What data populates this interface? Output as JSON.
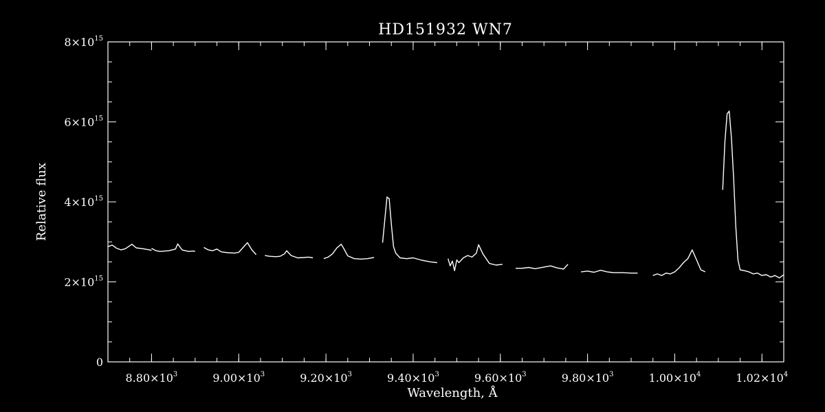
{
  "chart_data": {
    "type": "line",
    "title": "HD151932   WN7",
    "xlabel": "Wavelength, Å",
    "ylabel": "Relative flux",
    "xlim": [
      8700,
      10250
    ],
    "ylim": [
      0,
      8000000000000000.0
    ],
    "grid": false,
    "line_color": "#ffffff",
    "background": "#000000",
    "x_ticks": [
      {
        "value": 8800,
        "mant": "8.80",
        "exp": "3"
      },
      {
        "value": 9000,
        "mant": "9.00",
        "exp": "3"
      },
      {
        "value": 9200,
        "mant": "9.20",
        "exp": "3"
      },
      {
        "value": 9400,
        "mant": "9.40",
        "exp": "3"
      },
      {
        "value": 9600,
        "mant": "9.60",
        "exp": "3"
      },
      {
        "value": 9800,
        "mant": "9.80",
        "exp": "3"
      },
      {
        "value": 10000,
        "mant": "1.00",
        "exp": "4"
      },
      {
        "value": 10200,
        "mant": "1.02",
        "exp": "4"
      }
    ],
    "y_ticks": [
      {
        "value": 0,
        "mant": "0",
        "exp": ""
      },
      {
        "value": 2000000000000000.0,
        "mant": "2",
        "exp": "15"
      },
      {
        "value": 4000000000000000.0,
        "mant": "4",
        "exp": "15"
      },
      {
        "value": 6000000000000000.0,
        "mant": "6",
        "exp": "15"
      },
      {
        "value": 8000000000000000.0,
        "mant": "8",
        "exp": "15"
      }
    ],
    "x_minor_step": 50,
    "y_minor_step": 500000000000000.0,
    "series": [
      {
        "segments": [
          {
            "x": [
              8700,
              8710,
              8720,
              8730,
              8740,
              8755,
              8765,
              8780,
              8790,
              8800
            ],
            "y": [
              2880000000000000.0,
              2920000000000000.0,
              2840000000000000.0,
              2800000000000000.0,
              2830000000000000.0,
              2940000000000000.0,
              2850000000000000.0,
              2830000000000000.0,
              2810000000000000.0,
              2790000000000000.0
            ]
          },
          {
            "x": [
              8800,
              8810,
              8820,
              8840,
              8855,
              8860,
              8870,
              8885,
              8895,
              8900
            ],
            "y": [
              2840000000000000.0,
              2780000000000000.0,
              2760000000000000.0,
              2780000000000000.0,
              2820000000000000.0,
              2950000000000000.0,
              2800000000000000.0,
              2760000000000000.0,
              2770000000000000.0,
              2760000000000000.0
            ]
          },
          {
            "x": [
              8920,
              8930,
              8940,
              8950,
              8960,
              8975,
              8990,
              9000,
              9010,
              9020,
              9030,
              9040
            ],
            "y": [
              2860000000000000.0,
              2800000000000000.0,
              2780000000000000.0,
              2820000000000000.0,
              2750000000000000.0,
              2730000000000000.0,
              2720000000000000.0,
              2740000000000000.0,
              2860000000000000.0,
              2980000000000000.0,
              2800000000000000.0,
              2680000000000000.0
            ]
          },
          {
            "x": [
              9060,
              9070,
              9085,
              9095,
              9105,
              9110,
              9120,
              9135,
              9150,
              9160,
              9170
            ],
            "y": [
              2660000000000000.0,
              2640000000000000.0,
              2630000000000000.0,
              2640000000000000.0,
              2700000000000000.0,
              2780000000000000.0,
              2660000000000000.0,
              2600000000000000.0,
              2610000000000000.0,
              2620000000000000.0,
              2600000000000000.0
            ]
          },
          {
            "x": [
              9195,
              9205,
              9215,
              9225,
              9235,
              9240,
              9250,
              9265,
              9280,
              9295,
              9310
            ],
            "y": [
              2580000000000000.0,
              2620000000000000.0,
              2700000000000000.0,
              2850000000000000.0,
              2940000000000000.0,
              2850000000000000.0,
              2650000000000000.0,
              2580000000000000.0,
              2570000000000000.0,
              2580000000000000.0,
              2610000000000000.0
            ]
          },
          {
            "x": [
              9330,
              9335,
              9340,
              9345,
              9350,
              9355,
              9360,
              9370,
              9385,
              9400,
              9420,
              9440,
              9455
            ],
            "y": [
              2980000000000000.0,
              3550000000000000.0,
              4120000000000000.0,
              4080000000000000.0,
              3450000000000000.0,
              2880000000000000.0,
              2720000000000000.0,
              2600000000000000.0,
              2580000000000000.0,
              2600000000000000.0,
              2540000000000000.0,
              2500000000000000.0,
              2480000000000000.0
            ]
          },
          {
            "x": [
              9480,
              9485,
              9490,
              9495,
              9500,
              9505,
              9515,
              9525,
              9535,
              9545,
              9550,
              9560,
              9575,
              9590,
              9605
            ],
            "y": [
              2580000000000000.0,
              2400000000000000.0,
              2520000000000000.0,
              2280000000000000.0,
              2550000000000000.0,
              2480000000000000.0,
              2600000000000000.0,
              2660000000000000.0,
              2620000000000000.0,
              2720000000000000.0,
              2930000000000000.0,
              2700000000000000.0,
              2460000000000000.0,
              2420000000000000.0,
              2440000000000000.0
            ]
          },
          {
            "x": [
              9635,
              9650,
              9665,
              9680,
              9700,
              9715,
              9730,
              9745,
              9755
            ],
            "y": [
              2340000000000000.0,
              2340000000000000.0,
              2360000000000000.0,
              2330000000000000.0,
              2370000000000000.0,
              2400000000000000.0,
              2350000000000000.0,
              2320000000000000.0,
              2440000000000000.0
            ]
          },
          {
            "x": [
              9785,
              9800,
              9815,
              9830,
              9845,
              9860,
              9880,
              9900,
              9915
            ],
            "y": [
              2250000000000000.0,
              2270000000000000.0,
              2240000000000000.0,
              2290000000000000.0,
              2250000000000000.0,
              2230000000000000.0,
              2230000000000000.0,
              2220000000000000.0,
              2220000000000000.0
            ]
          },
          {
            "x": [
              9950,
              9960,
              9970,
              9980,
              9990,
              10000,
              10010,
              10020,
              10030,
              10040,
              10050,
              10060,
              10070
            ],
            "y": [
              2160000000000000.0,
              2200000000000000.0,
              2160000000000000.0,
              2220000000000000.0,
              2200000000000000.0,
              2250000000000000.0,
              2350000000000000.0,
              2480000000000000.0,
              2580000000000000.0,
              2800000000000000.0,
              2550000000000000.0,
              2300000000000000.0,
              2250000000000000.0
            ]
          },
          {
            "x": [
              10110,
              10115,
              10120,
              10125,
              10130,
              10135,
              10140,
              10145,
              10150,
              10160,
              10170,
              10180,
              10190,
              10200,
              10210,
              10220,
              10230,
              10240,
              10250
            ],
            "y": [
              4300000000000000.0,
              5500000000000000.0,
              6200000000000000.0,
              6270000000000000.0,
              5600000000000000.0,
              4600000000000000.0,
              3400000000000000.0,
              2550000000000000.0,
              2300000000000000.0,
              2280000000000000.0,
              2250000000000000.0,
              2200000000000000.0,
              2220000000000000.0,
              2160000000000000.0,
              2180000000000000.0,
              2120000000000000.0,
              2160000000000000.0,
              2100000000000000.0,
              2180000000000000.0
            ]
          }
        ]
      }
    ]
  }
}
